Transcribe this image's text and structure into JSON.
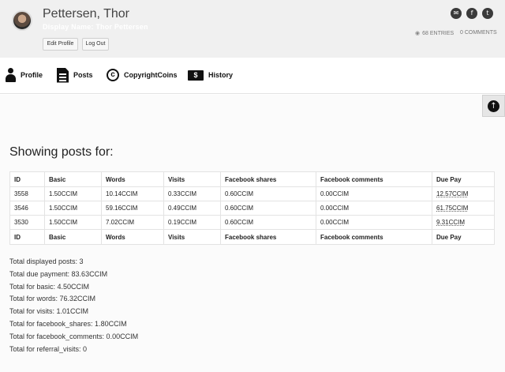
{
  "user": {
    "name": "Pettersen, Thor",
    "subtitle": "Display Name: Thor Pettersen",
    "edit_label": "Edit Profile",
    "logout_label": "Log Out",
    "entries": "68 ENTRIES",
    "comments": "0 COMMENTS"
  },
  "social": {
    "mail": "✉",
    "facebook": "f",
    "twitter": "t"
  },
  "nav": {
    "profile": "Profile",
    "posts": "Posts",
    "copyright": "CopyrightCoins",
    "history": "History"
  },
  "main": {
    "scroll_icon": "↑",
    "heading": "Showing posts for:",
    "columns": [
      "ID",
      "Basic",
      "Words",
      "Visits",
      "Facebook shares",
      "Facebook comments",
      "Due Pay"
    ],
    "rows": [
      [
        "3558",
        "1.50CCIM",
        "10.14CCIM",
        "0.33CCIM",
        "0.60CCIM",
        "0.00CCIM",
        "12.57CCIM"
      ],
      [
        "3546",
        "1.50CCIM",
        "59.16CCIM",
        "0.49CCIM",
        "0.60CCIM",
        "0.00CCIM",
        "61.75CCIM"
      ],
      [
        "3530",
        "1.50CCIM",
        "7.02CCIM",
        "0.19CCIM",
        "0.60CCIM",
        "0.00CCIM",
        "9.31CCIM"
      ]
    ],
    "totals": [
      "Total displayed posts: 3",
      "Total due payment: 83.63CCIM",
      "Total for basic: 4.50CCIM",
      "Total for words: 76.32CCIM",
      "Total for visits: 1.01CCIM",
      "Total for facebook_shares: 1.80CCIM",
      "Total for facebook_comments: 0.00CCIM",
      "Total for referral_visits: 0"
    ]
  }
}
